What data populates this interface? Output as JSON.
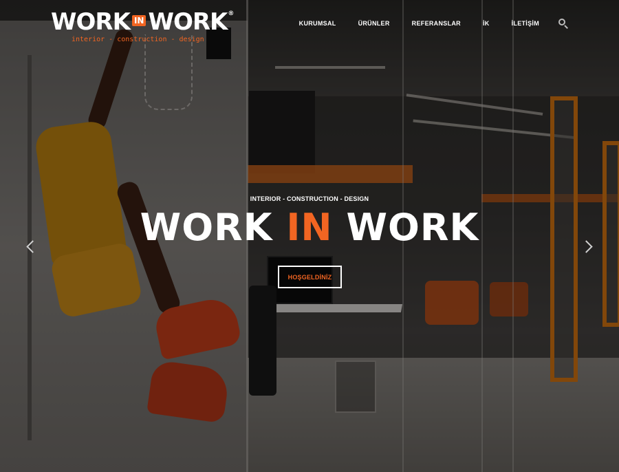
{
  "brand": {
    "logo_left": "WORK",
    "logo_badge": "IN",
    "logo_right": "WORK",
    "logo_mark": "®",
    "tagline": "interior - construction - design",
    "accent_color": "#f26522"
  },
  "nav": {
    "items": [
      {
        "label": "KURUMSAL"
      },
      {
        "label": "ÜRÜNLER"
      },
      {
        "label": "REFERANSLAR"
      },
      {
        "label": "İK"
      },
      {
        "label": "İLETİŞİM"
      }
    ],
    "search_icon": "search-icon"
  },
  "hero": {
    "subtitle": "INTERIOR - CONSTRUCTION - DESIGN",
    "title_left": "WORK",
    "title_accent": "IN",
    "title_right": "WORK",
    "cta_label": "HOŞGELDİNİZ",
    "prev_icon": "chevron-left-icon",
    "next_icon": "chevron-right-icon"
  }
}
